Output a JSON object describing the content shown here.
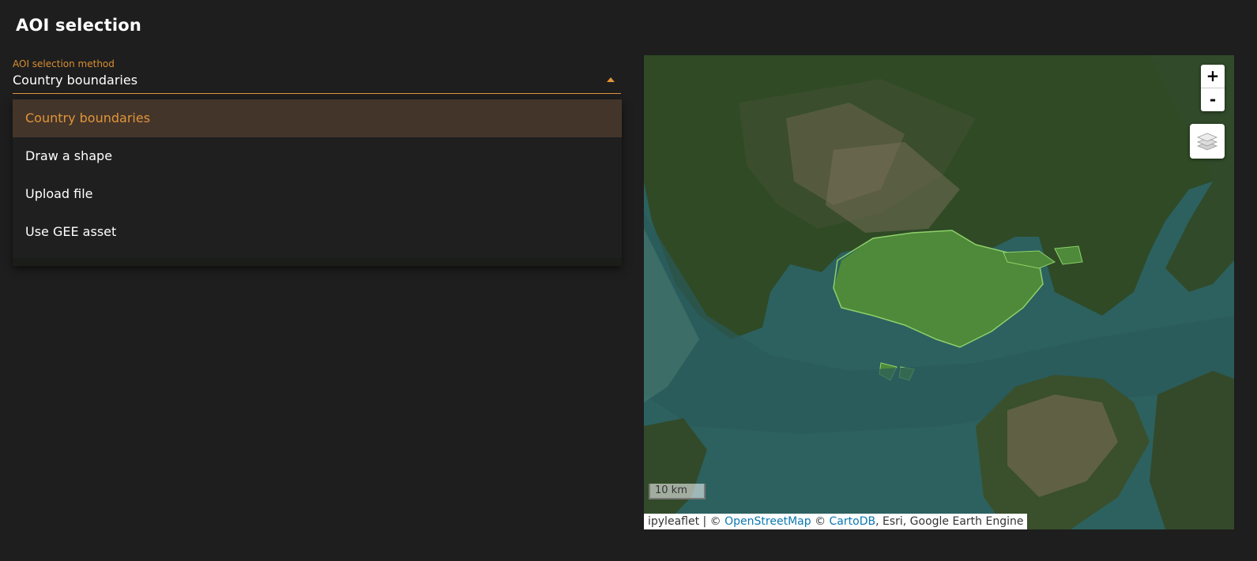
{
  "page": {
    "title": "AOI selection"
  },
  "aoi_select": {
    "label": "AOI selection method",
    "value": "Country boundaries",
    "options": [
      "Country boundaries",
      "Draw a shape",
      "Upload file",
      "Use GEE asset"
    ]
  },
  "map": {
    "zoom_in": "+",
    "zoom_out": "-",
    "scale": "10 km",
    "attribution": {
      "prefix": "ipyleaflet | © ",
      "osm": "OpenStreetMap",
      "mid": " © ",
      "carto": "CartoDB",
      "suffix": ", Esri, Google Earth Engine"
    }
  },
  "colors": {
    "accent": "#e0953a",
    "background": "#1e1e1e"
  }
}
